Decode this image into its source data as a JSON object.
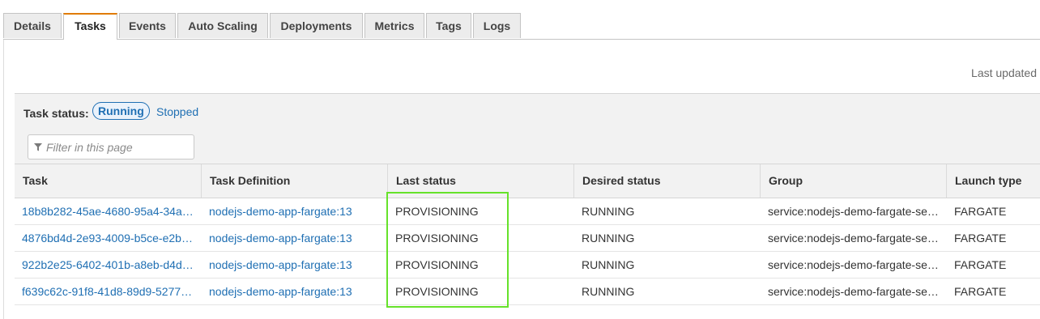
{
  "tabs": [
    {
      "label": "Details",
      "active": false
    },
    {
      "label": "Tasks",
      "active": true
    },
    {
      "label": "Events",
      "active": false
    },
    {
      "label": "Auto Scaling",
      "active": false
    },
    {
      "label": "Deployments",
      "active": false
    },
    {
      "label": "Metrics",
      "active": false
    },
    {
      "label": "Tags",
      "active": false
    },
    {
      "label": "Logs",
      "active": false
    }
  ],
  "last_updated_label": "Last updated",
  "task_status": {
    "label": "Task status:",
    "running_label": "Running",
    "stopped_label": "Stopped"
  },
  "filter": {
    "placeholder": "Filter in this page",
    "value": "",
    "icon": "filter-icon"
  },
  "table": {
    "columns": [
      "Task",
      "Task Definition",
      "Last status",
      "Desired status",
      "Group",
      "Launch type"
    ],
    "rows": [
      {
        "task": "18b8b282-45ae-4680-95a4-34a…",
        "task_definition": "nodejs-demo-app-fargate:13",
        "last_status": "PROVISIONING",
        "desired_status": "RUNNING",
        "group": "service:nodejs-demo-fargate-se…",
        "launch_type": "FARGATE"
      },
      {
        "task": "4876bd4d-2e93-4009-b5ce-e2b…",
        "task_definition": "nodejs-demo-app-fargate:13",
        "last_status": "PROVISIONING",
        "desired_status": "RUNNING",
        "group": "service:nodejs-demo-fargate-se…",
        "launch_type": "FARGATE"
      },
      {
        "task": "922b2e25-6402-401b-a8eb-d4d…",
        "task_definition": "nodejs-demo-app-fargate:13",
        "last_status": "PROVISIONING",
        "desired_status": "RUNNING",
        "group": "service:nodejs-demo-fargate-se…",
        "launch_type": "FARGATE"
      },
      {
        "task": "f639c62c-91f8-41d8-89d9-5277…",
        "task_definition": "nodejs-demo-app-fargate:13",
        "last_status": "PROVISIONING",
        "desired_status": "RUNNING",
        "group": "service:nodejs-demo-fargate-se…",
        "launch_type": "FARGATE"
      }
    ]
  },
  "colors": {
    "link": "#1f6fb3",
    "active_tab_accent": "#e07b00",
    "highlight": "#66e22a"
  }
}
